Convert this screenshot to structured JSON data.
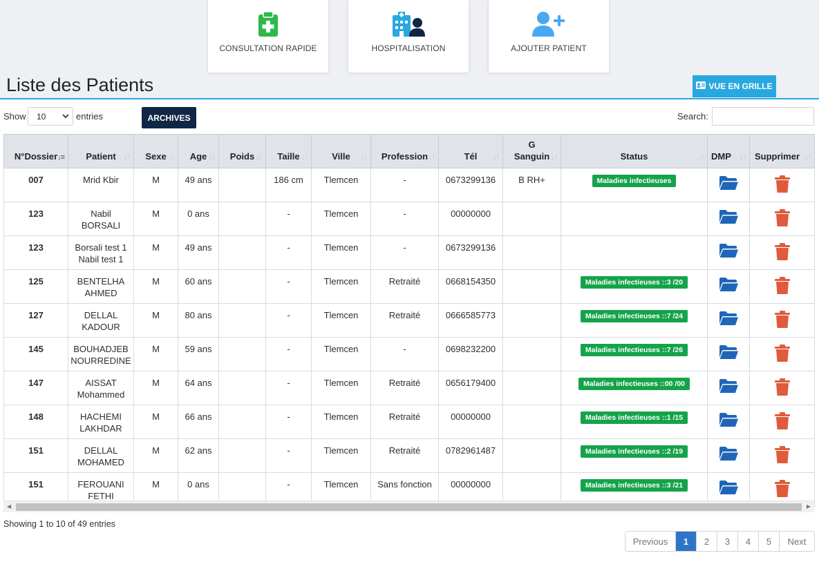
{
  "cards": [
    {
      "label": "CONSULTATION RAPIDE",
      "icon": "clipboard-medical-icon",
      "color": "#2eb84c"
    },
    {
      "label": "HOSPITALISATION",
      "icon": "hospital-doctor-icon",
      "color": "#29a8e0"
    },
    {
      "label": "AJOUTER PATIENT",
      "icon": "user-plus-icon",
      "color": "#4aa8f0"
    }
  ],
  "page_title": "Liste des Patients",
  "grid_button_label": "VUE EN GRILLE",
  "controls": {
    "show_label": "Show",
    "page_length": "10",
    "entries_label": "entries",
    "archives_label": "ARCHIVES",
    "search_label": "Search:",
    "search_value": ""
  },
  "table": {
    "headers": [
      "N°Dossier",
      "Patient",
      "Sexe",
      "Age",
      "Poids",
      "Taille",
      "Ville",
      "Profession",
      "Tél",
      "G Sanguin",
      "Status",
      "DMP",
      "Supprimer"
    ],
    "rows": [
      {
        "dossier": "007",
        "patient": "Mrid Kbir",
        "sexe": "M",
        "age": "49 ans",
        "poids": "",
        "taille": "186 cm",
        "ville": "Tlemcen",
        "profession": "-",
        "tel": "0673299136",
        "gsanguin": "B RH+",
        "status": "Maladies infectieuses"
      },
      {
        "dossier": "123",
        "patient": "Nabil BORSALI",
        "sexe": "M",
        "age": "0 ans",
        "poids": "",
        "taille": "-",
        "ville": "Tlemcen",
        "profession": "-",
        "tel": "00000000",
        "gsanguin": "",
        "status": ""
      },
      {
        "dossier": "123",
        "patient": "Borsali test 1 Nabil test 1",
        "sexe": "M",
        "age": "49 ans",
        "poids": "",
        "taille": "-",
        "ville": "Tlemcen",
        "profession": "-",
        "tel": "0673299136",
        "gsanguin": "",
        "status": ""
      },
      {
        "dossier": "125",
        "patient": "BENTELHA AHMED",
        "sexe": "M",
        "age": "60 ans",
        "poids": "",
        "taille": "-",
        "ville": "Tlemcen",
        "profession": "Retraité",
        "tel": "0668154350",
        "gsanguin": "",
        "status": "Maladies infectieuses ::3 /20"
      },
      {
        "dossier": "127",
        "patient": "DELLAL KADOUR",
        "sexe": "M",
        "age": "80 ans",
        "poids": "",
        "taille": "-",
        "ville": "Tlemcen",
        "profession": "Retraité",
        "tel": "0666585773",
        "gsanguin": "",
        "status": "Maladies infectieuses ::7 /24"
      },
      {
        "dossier": "145",
        "patient": "BOUHADJEB NOURREDINE",
        "sexe": "M",
        "age": "59 ans",
        "poids": "",
        "taille": "-",
        "ville": "Tlemcen",
        "profession": "-",
        "tel": "0698232200",
        "gsanguin": "",
        "status": "Maladies infectieuses ::7 /26"
      },
      {
        "dossier": "147",
        "patient": "AISSAT Mohammed",
        "sexe": "M",
        "age": "64 ans",
        "poids": "",
        "taille": "-",
        "ville": "Tlemcen",
        "profession": "Retraité",
        "tel": "0656179400",
        "gsanguin": "",
        "status": "Maladies infectieuses ::00 /00"
      },
      {
        "dossier": "148",
        "patient": "HACHEMI LAKHDAR",
        "sexe": "M",
        "age": "66 ans",
        "poids": "",
        "taille": "-",
        "ville": "Tlemcen",
        "profession": "Retraité",
        "tel": "00000000",
        "gsanguin": "",
        "status": "Maladies infectieuses ::1 /15"
      },
      {
        "dossier": "151",
        "patient": "DELLAL MOHAMED",
        "sexe": "M",
        "age": "62 ans",
        "poids": "",
        "taille": "-",
        "ville": "Tlemcen",
        "profession": "Retraité",
        "tel": "0782961487",
        "gsanguin": "",
        "status": "Maladies infectieuses ::2 /19"
      },
      {
        "dossier": "151",
        "patient": "FEROUANI FETHI",
        "sexe": "M",
        "age": "0 ans",
        "poids": "",
        "taille": "-",
        "ville": "Tlemcen",
        "profession": "Sans fonction",
        "tel": "00000000",
        "gsanguin": "",
        "status": "Maladies infectieuses ::3 /21"
      }
    ]
  },
  "info": "Showing 1 to 10 of 49 entries",
  "pagination": {
    "previous": "Previous",
    "pages": [
      "1",
      "2",
      "3",
      "4",
      "5"
    ],
    "active": "1",
    "next": "Next"
  },
  "colors": {
    "accent": "#29a8e0",
    "archives_bg": "#0f2744",
    "badge": "#15a34a",
    "folder": "#1f66b8",
    "trash": "#e05a3c",
    "pager_active": "#2f75c7"
  }
}
